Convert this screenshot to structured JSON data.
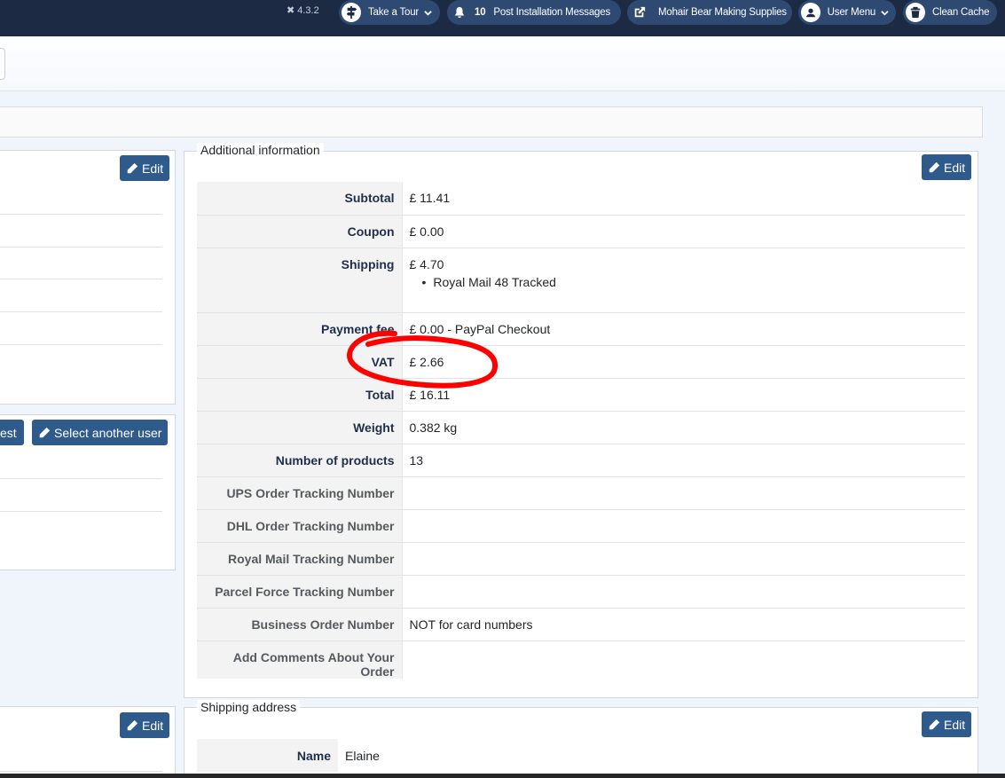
{
  "topbar": {
    "version": "4.3.2",
    "take_tour": "Take a Tour",
    "post_install_count": "10",
    "post_install": "Post Installation Messages",
    "site_name": "Mohair Bear Making Supplies",
    "user_menu": "User Menu",
    "clean_cache": "Clean Cache"
  },
  "left": {
    "edit_label": "Edit",
    "guest_fragment": "est",
    "select_user": "Select another user",
    "edit_bottom": "Edit"
  },
  "additional": {
    "legend": "Additional information",
    "edit_label": "Edit",
    "rows": [
      {
        "key": "Subtotal",
        "value": "£ 11.41"
      },
      {
        "key": "Coupon",
        "value": "£ 0.00"
      },
      {
        "key": "Shipping",
        "value": "£ 4.70",
        "sub": "Royal Mail 48 Tracked"
      },
      {
        "key": "Payment fee",
        "value": "£ 0.00 - PayPal Checkout"
      },
      {
        "key": "VAT",
        "value": "£ 2.66"
      },
      {
        "key": "Total",
        "value": "£ 16.11"
      },
      {
        "key": "Weight",
        "value": "0.382 kg"
      },
      {
        "key": "Number of products",
        "value": "13"
      },
      {
        "key": "UPS Order Tracking Number",
        "value": ""
      },
      {
        "key": "DHL Order Tracking Number",
        "value": ""
      },
      {
        "key": "Royal Mail Tracking Number",
        "value": ""
      },
      {
        "key": "Parcel Force Tracking Number",
        "value": ""
      },
      {
        "key": "Business Order Number",
        "value": "NOT for card numbers"
      },
      {
        "key": "Add Comments About Your Order",
        "value": ""
      }
    ]
  },
  "shipping": {
    "legend": "Shipping address",
    "edit_label": "Edit",
    "name_key": "Name",
    "name_value": "Elaine"
  },
  "colors": {
    "topbar": "#1c2a44",
    "pill": "#2f4a72",
    "button": "#2f5a8c",
    "annotation": "#ff0000"
  }
}
